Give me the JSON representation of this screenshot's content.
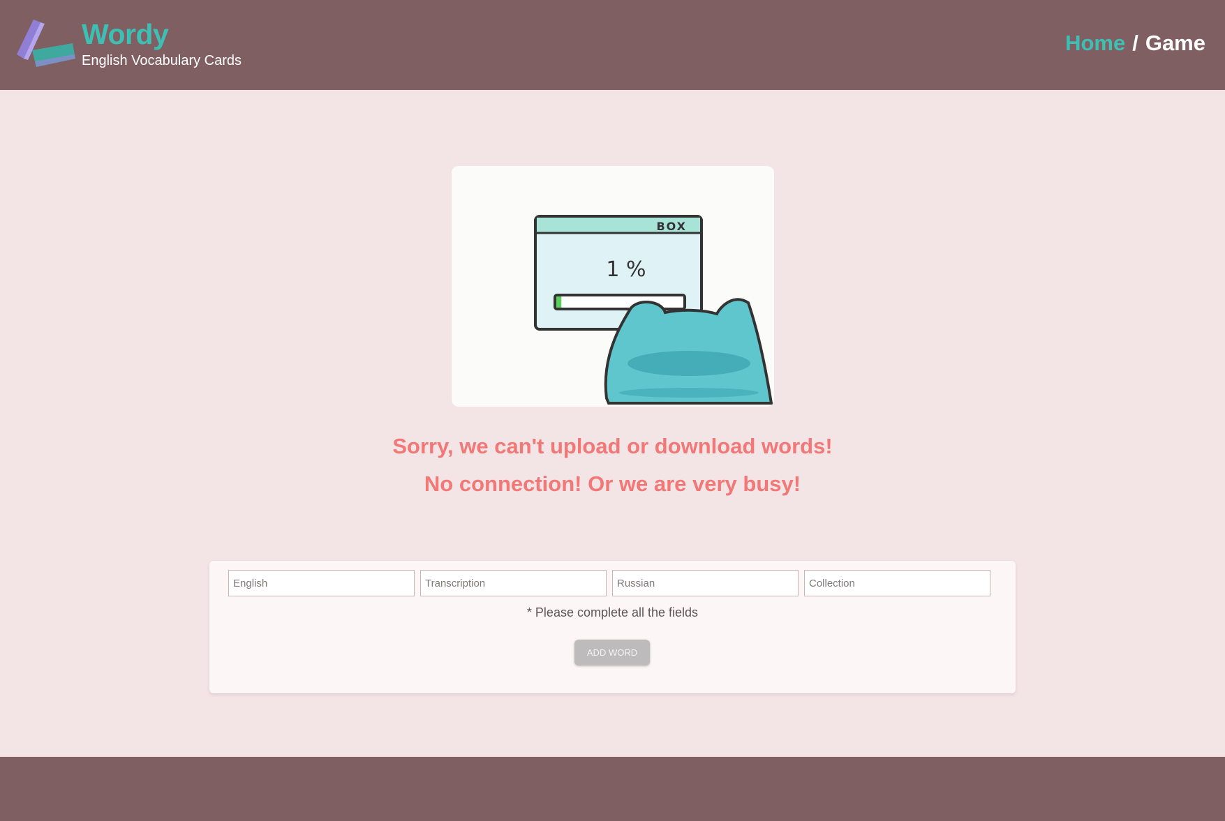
{
  "header": {
    "brand_name": "Wordy",
    "brand_subtitle": "English Vocabulary Cards",
    "nav": {
      "home": "Home",
      "separator": "/",
      "current": "Game"
    }
  },
  "illustration": {
    "box_label": "BOX",
    "progress_text": "1 %",
    "progress": 0.01
  },
  "error": {
    "line1": "Sorry, we can't upload or download words!",
    "line2": "No connection! Or we are very busy!"
  },
  "form": {
    "fields": [
      {
        "placeholder": "English",
        "value": ""
      },
      {
        "placeholder": "Transcription",
        "value": ""
      },
      {
        "placeholder": "Russian",
        "value": ""
      },
      {
        "placeholder": "Collection",
        "value": ""
      }
    ],
    "hint": "* Please complete all the fields",
    "add_button": "ADD WORD"
  },
  "colors": {
    "header_bg": "#805f63",
    "page_bg": "#f3e4e5",
    "accent": "#3dbfb3",
    "error": "#f27878"
  }
}
